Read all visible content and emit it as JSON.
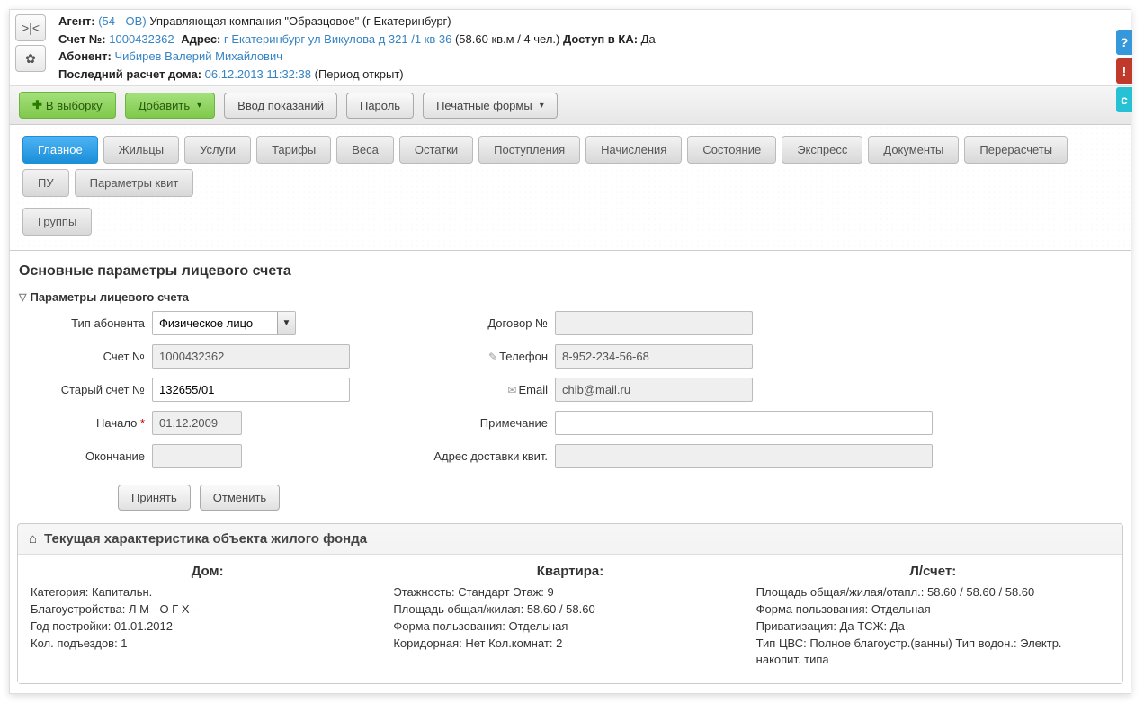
{
  "header": {
    "agent_label": "Агент:",
    "agent_code": "(54 - ОВ)",
    "agent_name": " Управляющая компания \"Образцовое\" (г Екатеринбург)",
    "account_label": "Счет №:",
    "account_no": "1000432362",
    "address_label": "Адрес:",
    "address": "г Екатеринбург ул Викулова д 321 /1 кв 36",
    "area_info": " (58.60 кв.м / 4 чел.) ",
    "access_label": "Доступ в КА:",
    "access_value": " Да",
    "subscriber_label": "Абонент:",
    "subscriber_name": "Чибирев Валерий Михайлович",
    "last_calc_label": "Последний расчет дома:",
    "last_calc_value": "06.12.2013 11:32:38",
    "last_calc_suffix": " (Период открыт)"
  },
  "toolbar": {
    "to_selection": "В выборку",
    "add": "Добавить",
    "readings": "Ввод показаний",
    "password": "Пароль",
    "print_forms": "Печатные формы"
  },
  "tabs": [
    "Главное",
    "Жильцы",
    "Услуги",
    "Тарифы",
    "Веса",
    "Остатки",
    "Поступления",
    "Начисления",
    "Состояние",
    "Экспресс",
    "Документы",
    "Перерасчеты",
    "ПУ",
    "Параметры квит",
    "Группы"
  ],
  "active_tab": 0,
  "section_title": "Основные параметры лицевого счета",
  "fieldset_title": "Параметры лицевого счета",
  "form": {
    "type_label": "Тип абонента",
    "type_value": "Физическое лицо",
    "account_label": "Счет №",
    "account_value": "1000432362",
    "old_account_label": "Старый счет №",
    "old_account_value": "132655/01",
    "start_label": "Начало",
    "start_value": "01.12.2009",
    "end_label": "Окончание",
    "end_value": "",
    "contract_label": "Договор №",
    "contract_value": "",
    "phone_label": "Телефон",
    "phone_value": "8-952-234-56-68",
    "email_label": "Email",
    "email_value": "chib@mail.ru",
    "note_label": "Примечание",
    "note_value": "",
    "delivery_label": "Адрес доставки квит.",
    "delivery_value": "",
    "submit": "Принять",
    "cancel": "Отменить"
  },
  "panel_title": "Текущая характеристика объекта жилого фонда",
  "house": {
    "title": "Дом:",
    "l1": "Категория: Капитальн.",
    "l2": "Благоустройства: Л М - О Г Х -",
    "l3": "Год постройки: 01.01.2012",
    "l4": "Кол. подъездов: 1"
  },
  "flat": {
    "title": "Квартира:",
    "l1": "Этажность: Стандарт Этаж: 9",
    "l2": "Площадь общая/жилая: 58.60 / 58.60",
    "l3": "Форма пользования: Отдельная",
    "l4": "Коридорная: Нет Кол.комнат: 2"
  },
  "ls": {
    "title": "Л/счет:",
    "l1": "Площадь общая/жилая/отапл.: 58.60 / 58.60 / 58.60",
    "l2": "Форма пользования: Отдельная",
    "l3": "Приватизация: Да ТСЖ: Да",
    "l4": "Тип ЦВС: Полное благоустр.(ванны) Тип водон.: Электр. накопит. типа"
  }
}
